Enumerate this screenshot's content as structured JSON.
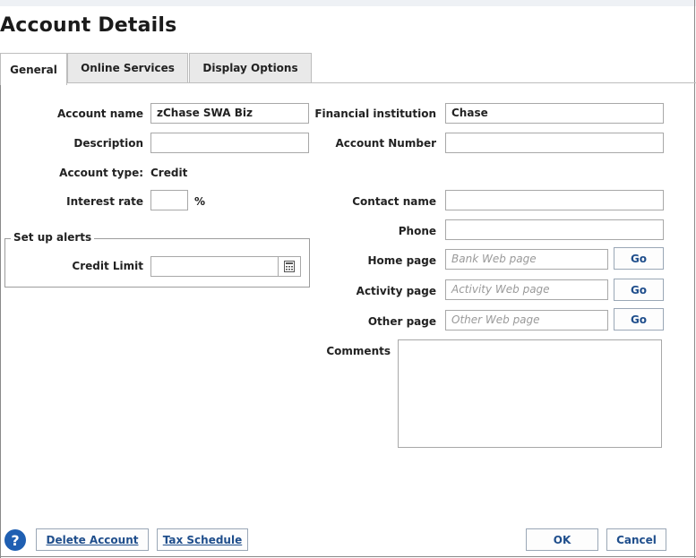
{
  "title": "Account Details",
  "tabs": [
    {
      "label": "General",
      "active": true
    },
    {
      "label": "Online Services",
      "active": false
    },
    {
      "label": "Display Options",
      "active": false
    }
  ],
  "general": {
    "account_name_label": "Account name",
    "account_name_value": "zChase SWA Biz",
    "description_label": "Description",
    "description_value": "",
    "account_type_label": "Account type:",
    "account_type_value": "Credit",
    "interest_rate_label": "Interest rate",
    "interest_rate_value": "",
    "interest_rate_unit": "%",
    "alerts_group_label": "Set up alerts",
    "credit_limit_label": "Credit Limit",
    "credit_limit_value": "",
    "financial_institution_label": "Financial institution",
    "financial_institution_value": "Chase",
    "account_number_label": "Account Number",
    "account_number_value": "",
    "contact_name_label": "Contact name",
    "contact_name_value": "",
    "phone_label": "Phone",
    "phone_value": "",
    "home_page_label": "Home page",
    "home_page_placeholder": "Bank Web page",
    "activity_page_label": "Activity page",
    "activity_page_placeholder": "Activity Web page",
    "other_page_label": "Other page",
    "other_page_placeholder": "Other Web page",
    "go_label": "Go",
    "comments_label": "Comments",
    "comments_value": ""
  },
  "footer": {
    "help_glyph": "?",
    "delete_account": "Delete Account",
    "tax_schedule": "Tax Schedule",
    "ok": "OK",
    "cancel": "Cancel"
  },
  "colors": {
    "link_blue": "#1f4e8c",
    "help_blue": "#1f5fb2"
  },
  "icons": {
    "calculator": "calculator-icon",
    "help": "help-icon"
  }
}
